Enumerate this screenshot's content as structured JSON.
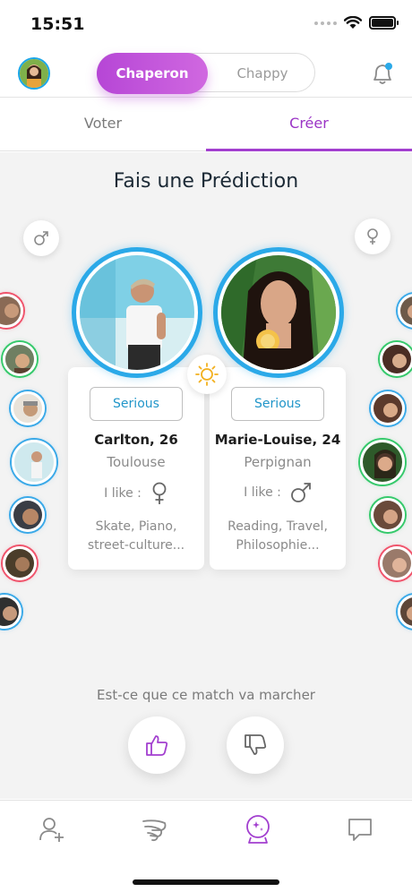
{
  "status_bar": {
    "time": "15:51"
  },
  "header": {
    "mode_options": [
      "Chaperon",
      "Chappy"
    ],
    "active_mode": "Chaperon"
  },
  "tabs": [
    {
      "label": "Voter",
      "active": false
    },
    {
      "label": "Créer",
      "active": true
    }
  ],
  "main": {
    "title": "Fais une Prédiction",
    "question": "Est-ce que ce match va marcher"
  },
  "profiles": [
    {
      "badge": "Serious",
      "name_age": "Carlton, 26",
      "city": "Toulouse",
      "likes_label": "I like :",
      "likes_icon": "female-symbol-icon",
      "interests_line1": "Skate, Piano,",
      "interests_line2": "street-culture..."
    },
    {
      "badge": "Serious",
      "name_age": "Marie-Louise, 24",
      "city": "Perpignan",
      "likes_label": "I like :",
      "likes_icon": "male-symbol-icon",
      "interests_line1": "Reading, Travel,",
      "interests_line2": "Philosophie..."
    }
  ],
  "colors": {
    "accent_purple": "#a23fcf",
    "accent_blue": "#2ba9e8",
    "ring_red": "#f0536b",
    "ring_green": "#35c96b"
  }
}
